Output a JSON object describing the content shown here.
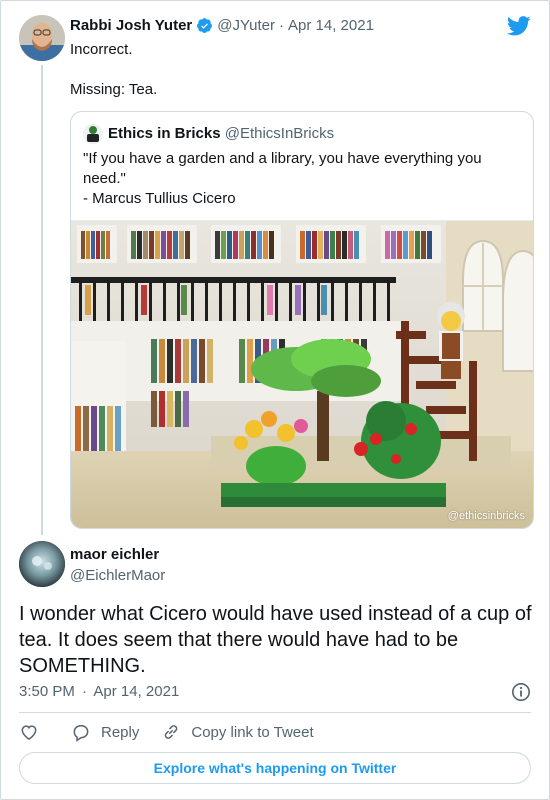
{
  "tweet": {
    "author_name": "Rabbi Josh Yuter",
    "author_handle": "@JYuter",
    "separator": "·",
    "date": "Apr 14, 2021",
    "text": "Incorrect.\n\nMissing: Tea."
  },
  "quoted_tweet": {
    "author_name": "Ethics in Bricks",
    "author_handle": "@EthicsInBricks",
    "text": "\"If you have a garden and a library, you have everything you need.\"\n- Marcus Tullius Cicero",
    "image_watermark": "@ethicsinbricks"
  },
  "reply": {
    "author_name": "maor eichler",
    "author_handle": "@EichlerMaor",
    "text": "I wonder what Cicero would have used instead of a cup of tea. It does seem that there would have had to be SOMETHING.",
    "time": "3:50 PM",
    "separator": "·",
    "date": "Apr 14, 2021"
  },
  "actions": {
    "reply_label": "Reply",
    "copy_link_label": "Copy link to Tweet"
  },
  "explore_label": "Explore what's happening on Twitter",
  "colors": {
    "accent": "#1d9bf0",
    "text": "#0f1419",
    "secondary": "#536471",
    "border": "#cfd9de"
  },
  "icons": [
    "verified-badge-icon",
    "twitter-bird-icon",
    "info-icon",
    "heart-icon",
    "reply-icon",
    "link-icon"
  ]
}
